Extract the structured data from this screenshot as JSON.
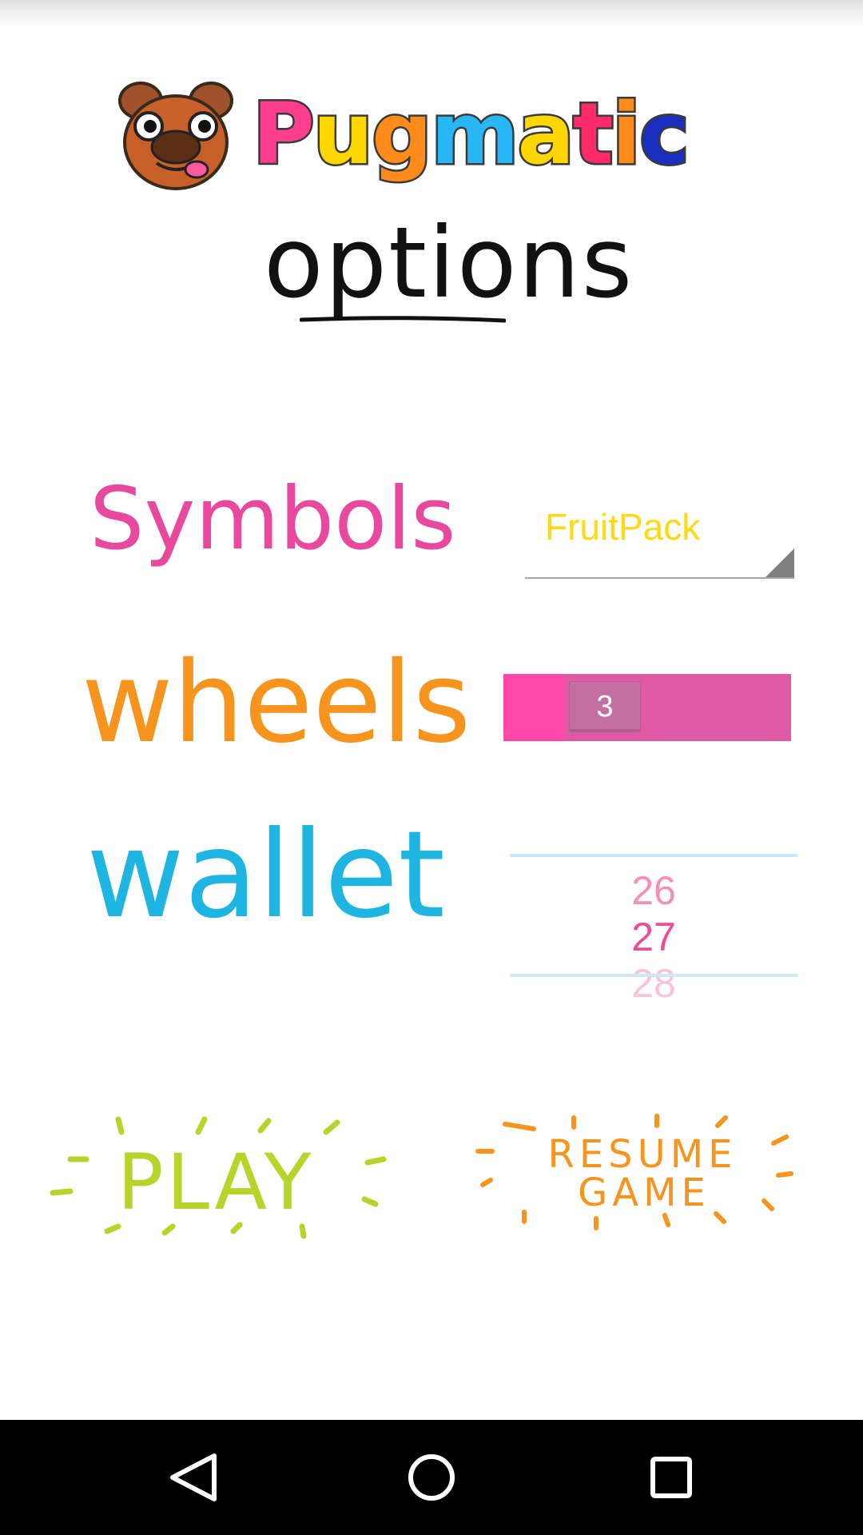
{
  "header": {
    "logo_text": "Pugmatic",
    "title": "options"
  },
  "options": {
    "symbols": {
      "label": "Symbols",
      "selected": "FruitPack"
    },
    "wheels": {
      "label": "wheels",
      "value": "3"
    },
    "wallet": {
      "label": "wallet",
      "values": [
        "26",
        "27",
        "28"
      ],
      "selected": "27"
    }
  },
  "buttons": {
    "play": "PLAY",
    "resume_line1": "RESUME",
    "resume_line2": "GAME"
  },
  "colors": {
    "symbols": "#e8499f",
    "wheels": "#f7941d",
    "wallet": "#1fb5e3",
    "play": "#b5d52a",
    "resume": "#f7941d",
    "spinner_text": "#ffd914",
    "seek_active": "#ff47a8",
    "seek_track": "#de5aa5"
  },
  "navbar": {
    "back": "back-icon",
    "home": "home-icon",
    "recents": "recents-icon"
  }
}
